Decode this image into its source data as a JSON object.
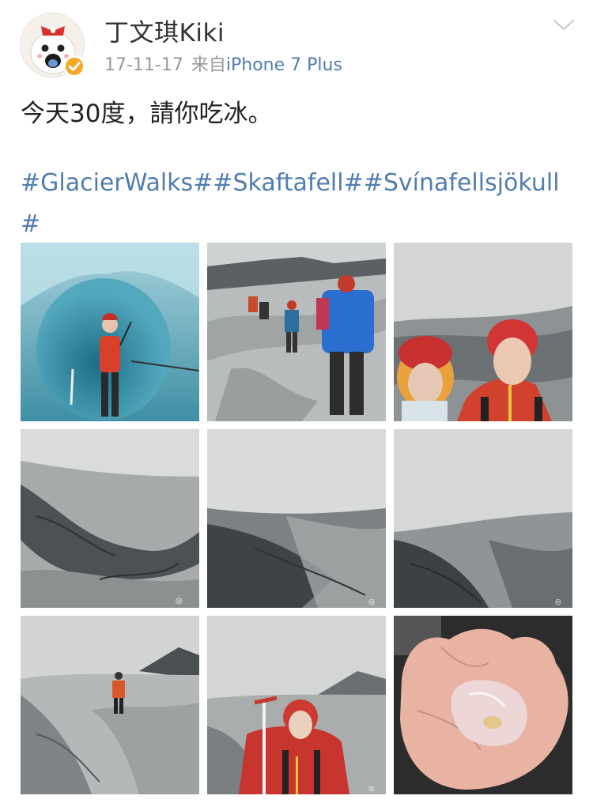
{
  "post": {
    "author": "丁文琪Kiki",
    "date": "17-11-17",
    "source_prefix": "来自",
    "device": "iPhone 7 Plus",
    "text": "今天30度，請你吃冰。",
    "hashtags": "#GlacierWalks##Skaftafell##Svínafellsjökull#",
    "accent_color": "#507daf",
    "verified_color": "#f5a623"
  },
  "icons": {
    "avatar": "cartoon-avatar",
    "verified": "verified-badge-icon",
    "menu": "chevron-down-icon"
  },
  "photos": [
    {
      "label": "ice-cave-climber-photo"
    },
    {
      "label": "hikers-on-glacier-photo"
    },
    {
      "label": "selfie-with-helmets-photo"
    },
    {
      "label": "glacier-crevasse-photo"
    },
    {
      "label": "glacier-fog-photo"
    },
    {
      "label": "glacier-ridge-photo"
    },
    {
      "label": "lone-hiker-glacier-photo"
    },
    {
      "label": "girl-with-ice-axe-photo"
    },
    {
      "label": "ice-in-hand-photo"
    }
  ]
}
